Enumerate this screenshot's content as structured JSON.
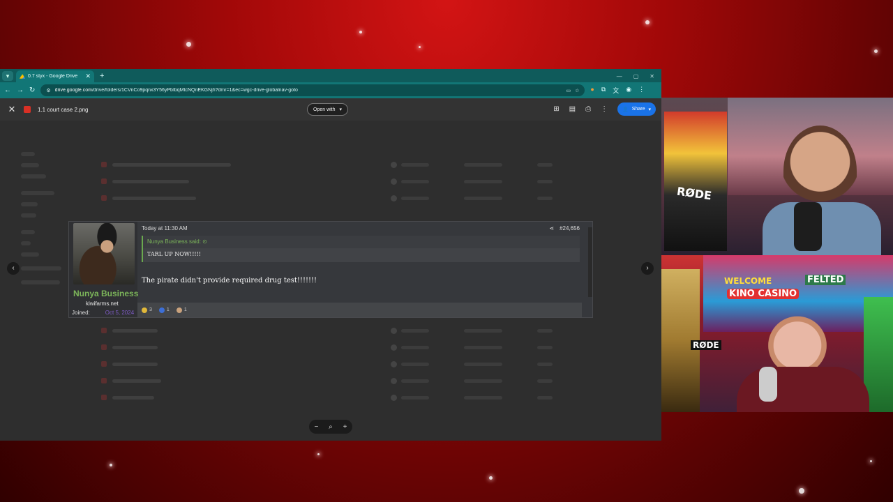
{
  "browser": {
    "tab_title": "0.7 styx - Google Drive",
    "url_domain": "drive.google.com",
    "url_path": "/drive/folders/1CVnCo9pqnx3Y56yPbIbqMtcNQnEKGNjh?dmr=1&ec=wgc-drive-globalnav-goto"
  },
  "viewer": {
    "filename": "1.1 court case 2.png",
    "open_with_label": "Open with",
    "share_label": "Share"
  },
  "post": {
    "date": "Today at 11:30 AM",
    "post_number": "#24,656",
    "quote_author": "Nunya Business said:",
    "quote_text": "TARL UP NOW!!!!!",
    "body_text": "The pirate didn't provide required drug test!!!!!!!",
    "username": "Nunya Business",
    "site": "kiwifarms.net",
    "joined_label": "Joined:",
    "joined_date": "Oct 5, 2024",
    "reactions": [
      {
        "icon": "pineapple-icon",
        "count": "3",
        "color": "#e0b83a"
      },
      {
        "icon": "info-icon",
        "count": "1",
        "color": "#3d6fd6"
      },
      {
        "icon": "face-icon",
        "count": "1",
        "color": "#c9a27d"
      }
    ]
  },
  "cams": {
    "cam1_sign": "RØDE",
    "cam2_sign_1": "WELCOME",
    "cam2_sign_2": "KINO CASINO",
    "cam2_sign_3": "FELTED",
    "cam2_mic": "RØDE"
  },
  "colors": {
    "drive_teal": "#127676",
    "share_blue": "#1a73e8",
    "username_green": "#7cb55a"
  }
}
